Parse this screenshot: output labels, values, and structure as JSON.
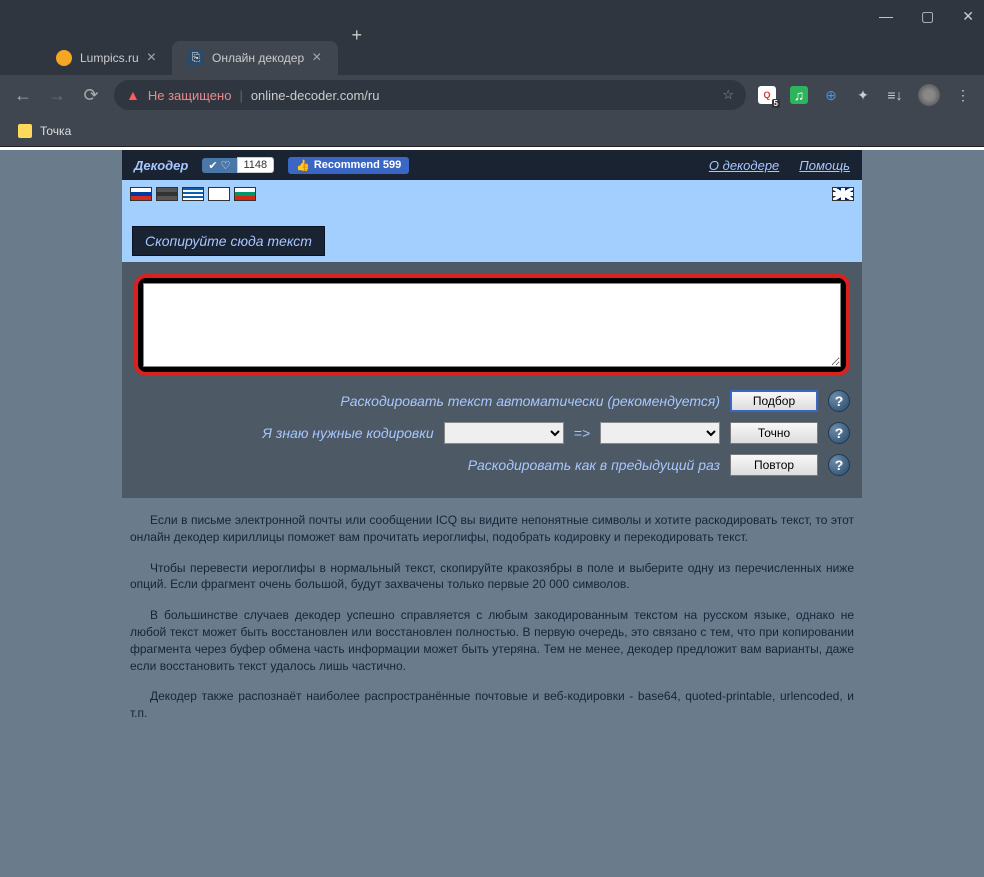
{
  "window": {
    "tab1": "Lumpics.ru",
    "tab2": "Онлайн декодер"
  },
  "address": {
    "warning": "Не защищено",
    "url": "online-decoder.com/ru"
  },
  "bookmarks": {
    "item1": "Точка"
  },
  "topbar": {
    "logo": "Декодер",
    "vk_count": "1148",
    "fb_label": "Recommend 599",
    "link_about": "О декодере",
    "link_help": "Помощь"
  },
  "section": {
    "title": "Скопируйте сюда текст"
  },
  "controls": {
    "row1_label": "Раскодировать текст автоматически (рекомендуется)",
    "row1_btn": "Подбор",
    "row2_label": "Я знаю нужные кодировки",
    "row2_arrow": "=>",
    "row2_btn": "Точно",
    "row3_label": "Раскодировать как в предыдущий раз",
    "row3_btn": "Повтор"
  },
  "paragraphs": {
    "p1": "Если в письме электронной почты или сообщении ICQ вы видите непонятные символы и хотите раскодировать текст, то этот онлайн декодер кириллицы поможет вам прочитать иероглифы, подобрать кодировку и перекодировать текст.",
    "p2": "Чтобы перевести иероглифы в нормальный текст, скопируйте кракозябры в поле и выберите одну из перечисленных ниже опций. Если фрагмент очень большой, будут захвачены только первые 20 000 символов.",
    "p3": "В большинстве случаев декодер успешно справляется с любым закодированным текстом на русском языке, однако не любой текст может быть восстановлен или восстановлен полностью. В первую очередь, это связано с тем, что при копировании фрагмента через буфер обмена часть информации может быть утеряна. Тем не менее, декодер предложит вам варианты, даже если восстановить текст удалось лишь частично.",
    "p4": "Декодер также распознаёт наиболее распространённые почтовые и веб-кодировки - base64, quoted-printable, urlencoded, и т.п."
  }
}
